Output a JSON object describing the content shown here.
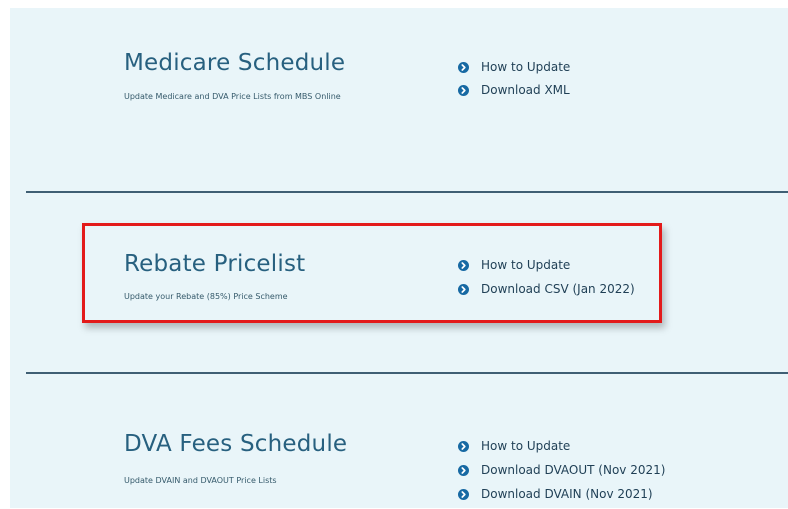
{
  "sections": [
    {
      "title": "Medicare Schedule",
      "description": "Update Medicare and DVA Price Lists from MBS Online",
      "links": [
        "How to Update",
        "Download XML"
      ]
    },
    {
      "title": "Rebate Pricelist",
      "description": "Update your Rebate (85%) Price Scheme",
      "links": [
        "How to Update",
        "Download CSV (Jan 2022)"
      ]
    },
    {
      "title": "DVA Fees Schedule",
      "description": "Update DVAIN and DVAOUT Price Lists",
      "links": [
        "How to Update",
        "Download DVAOUT (Nov 2021)",
        "Download DVAIN (Nov 2021)"
      ]
    }
  ],
  "colors": {
    "panel_background": "#e9f5f9",
    "title": "#27607f",
    "link_bullet": "#1769a3",
    "divider": "#3f5f74",
    "highlight_border": "#e31a1a"
  },
  "icons": {
    "link_bullet": "chevron-right-circle-icon"
  }
}
